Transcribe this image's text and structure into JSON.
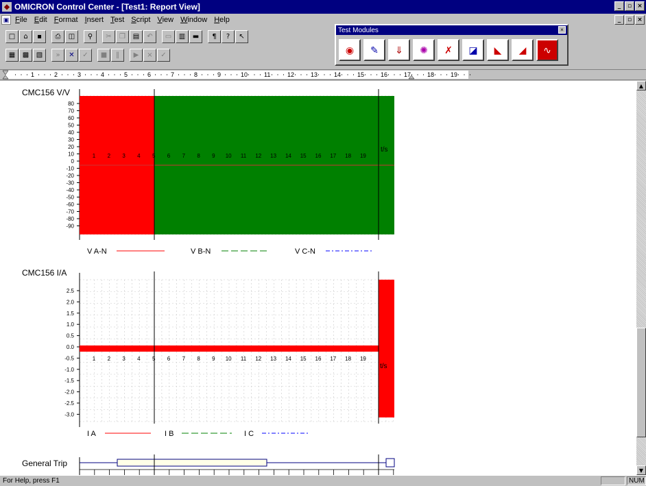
{
  "window": {
    "title": "OMICRON Control Center - [Test1: Report View]",
    "controls": [
      "_",
      "▫",
      "×"
    ]
  },
  "menu": {
    "items": [
      "File",
      "Edit",
      "Format",
      "Insert",
      "Test",
      "Script",
      "View",
      "Window",
      "Help"
    ]
  },
  "toolbar1": {
    "buttons": [
      "new-icon",
      "open-icon",
      "save-icon",
      "print-icon",
      "print-preview-icon",
      "find-icon",
      "cut-icon",
      "copy-icon",
      "paste-icon",
      "undo-icon",
      "view-normal-icon",
      "view-split-icon",
      "view-report-icon",
      "paragraph-icon",
      "help-icon",
      "context-help-icon"
    ]
  },
  "toolbar2": {
    "buttons": [
      "calculator-icon",
      "hardware-icon",
      "sequencer-icon",
      "start-all-icon",
      "run-all-icon",
      "check-icon",
      "stop-icon",
      "pause-icon",
      "play-icon",
      "clear-icon",
      "accept-icon"
    ]
  },
  "test_modules": {
    "title": "Test Modules",
    "close": "×",
    "buttons": [
      "quickcmc-module-icon",
      "state-sequencer-icon",
      "ramping-icon",
      "pulse-ramping-icon",
      "overcurrent-icon",
      "distance-icon",
      "differential-icon",
      "autoreclosure-icon",
      "transplay-icon"
    ]
  },
  "ruler": {
    "labels": [
      "1",
      "2",
      "3",
      "4",
      "5",
      "6",
      "7",
      "8",
      "9",
      "10",
      "11",
      "12",
      "13",
      "14",
      "15",
      "16",
      "17",
      "18",
      "19"
    ]
  },
  "voltage_plot": {
    "title": "CMC156 V/V",
    "y_ticks": [
      "80",
      "70",
      "60",
      "50",
      "40",
      "30",
      "20",
      "10",
      "0",
      "-10",
      "-20",
      "-30",
      "-40",
      "-50",
      "-60",
      "-70",
      "-80",
      "-90"
    ],
    "x_ticks": [
      "1",
      "2",
      "3",
      "4",
      "5",
      "6",
      "7",
      "8",
      "9",
      "10",
      "11",
      "12",
      "13",
      "14",
      "15",
      "16",
      "17",
      "18",
      "19"
    ],
    "x_unit": "t/s",
    "legend": [
      "V A-N",
      "V B-N",
      "V C-N"
    ],
    "colors": {
      "a": "#ff0000",
      "b": "#008000",
      "c": "#0000ff"
    }
  },
  "current_plot": {
    "title": "CMC156 I/A",
    "y_ticks": [
      "2.5",
      "2.0",
      "1.5",
      "1.0",
      "0.5",
      "0.0",
      "-0.5",
      "-1.0",
      "-1.5",
      "-2.0",
      "-2.5",
      "-3.0"
    ],
    "x_ticks": [
      "1",
      "2",
      "3",
      "4",
      "5",
      "6",
      "7",
      "8",
      "9",
      "10",
      "11",
      "12",
      "13",
      "14",
      "15",
      "16",
      "17",
      "18",
      "19"
    ],
    "x_unit": "t/s",
    "legend": [
      "I A",
      "I B",
      "I C"
    ]
  },
  "trip_plot": {
    "title": "General Trip"
  },
  "statusbar": {
    "text": "For Help, press F1",
    "indicator": "NUM"
  }
}
